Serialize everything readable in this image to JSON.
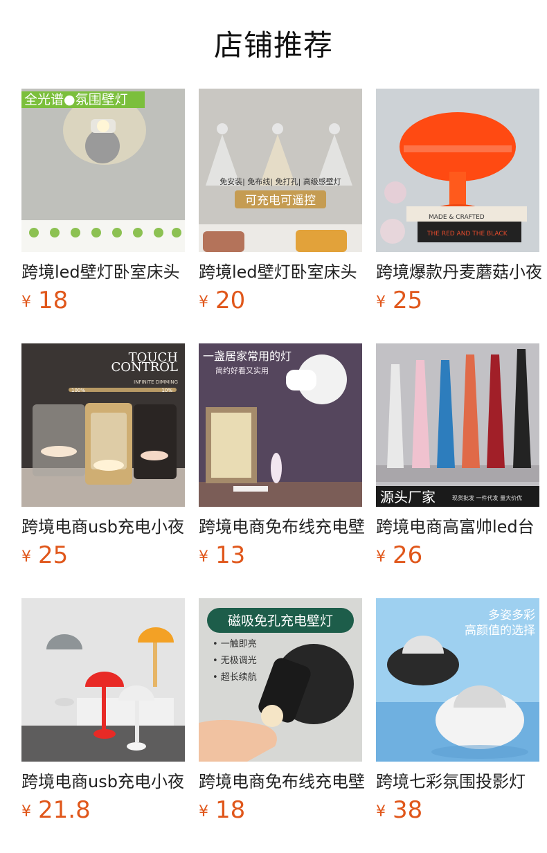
{
  "header": {
    "title": "店铺推荐"
  },
  "products": [
    {
      "name": "跨境led壁灯卧室床头",
      "currency": "¥",
      "price": "18",
      "image_text": [
        "全光谱●氛围壁灯"
      ]
    },
    {
      "name": "跨境led壁灯卧室床头",
      "currency": "¥",
      "price": "20",
      "image_text": [
        "免安装| 免布线| 免打孔| 高级感壁灯",
        "可充电可遥控"
      ]
    },
    {
      "name": "跨境爆款丹麦蘑菇小夜",
      "currency": "¥",
      "price": "25",
      "image_text": [
        "MADE & CRAFTED",
        "THE RED AND THE BLACK"
      ]
    },
    {
      "name": "跨境电商usb充电小夜",
      "currency": "¥",
      "price": "25",
      "image_text": [
        "TOUCH",
        "CONTROL",
        "INFINITE DIMMING",
        "100%",
        "10%"
      ]
    },
    {
      "name": "跨境电商免布线充电壁",
      "currency": "¥",
      "price": "13",
      "image_text": [
        "一盏居家常用的灯",
        "简约好看又实用"
      ]
    },
    {
      "name": "跨境电商高富帅led台",
      "currency": "¥",
      "price": "26",
      "image_text": [
        "源头厂家",
        "现货批发  一件代发  量大价优"
      ]
    },
    {
      "name": "跨境电商usb充电小夜",
      "currency": "¥",
      "price": "21.8",
      "image_text": []
    },
    {
      "name": "跨境电商免布线充电壁",
      "currency": "¥",
      "price": "18",
      "image_text": [
        "磁吸免孔充电壁灯",
        "• 一触即亮",
        "• 无极调光",
        "• 超长续航"
      ]
    },
    {
      "name": "跨境七彩氛围投影灯",
      "currency": "¥",
      "price": "38",
      "image_text": [
        "多姿多彩",
        "高颜值的选择"
      ]
    }
  ],
  "colors": {
    "price": "#e0571b",
    "title": "#111111",
    "name": "#222222"
  }
}
